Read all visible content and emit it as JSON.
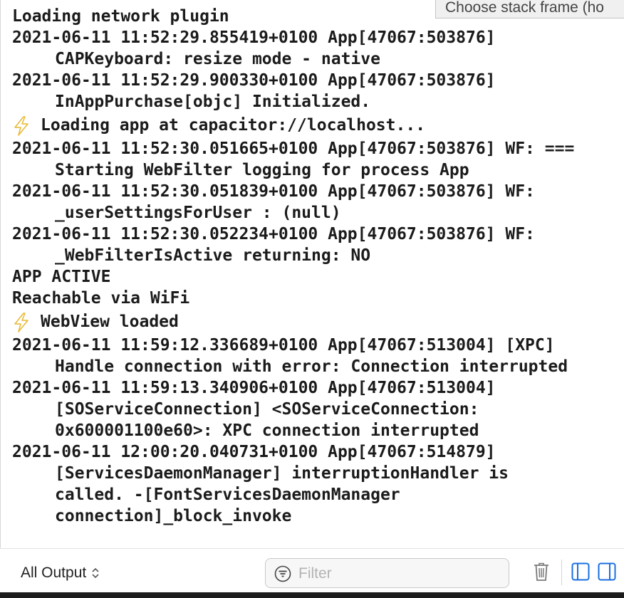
{
  "tooltip": {
    "text": "Choose stack frame (ho"
  },
  "log": [
    {
      "text": "Loading network plugin",
      "cont": false,
      "bolt": false
    },
    {
      "text": "2021-06-11 11:52:29.855419+0100 App[47067:503876]",
      "cont": false,
      "bolt": false
    },
    {
      "text": "CAPKeyboard: resize mode - native",
      "cont": true,
      "bolt": false
    },
    {
      "text": "2021-06-11 11:52:29.900330+0100 App[47067:503876]",
      "cont": false,
      "bolt": false
    },
    {
      "text": "InAppPurchase[objc] Initialized.",
      "cont": true,
      "bolt": false
    },
    {
      "text": "Loading app at capacitor://localhost...",
      "cont": false,
      "bolt": true
    },
    {
      "text": "2021-06-11 11:52:30.051665+0100 App[47067:503876] WF: ===",
      "cont": false,
      "bolt": false
    },
    {
      "text": "Starting WebFilter logging for process App",
      "cont": true,
      "bolt": false
    },
    {
      "text": "2021-06-11 11:52:30.051839+0100 App[47067:503876] WF:",
      "cont": false,
      "bolt": false
    },
    {
      "text": "_userSettingsForUser : (null)",
      "cont": true,
      "bolt": false
    },
    {
      "text": "2021-06-11 11:52:30.052234+0100 App[47067:503876] WF:",
      "cont": false,
      "bolt": false
    },
    {
      "text": "_WebFilterIsActive returning: NO",
      "cont": true,
      "bolt": false
    },
    {
      "text": "APP ACTIVE",
      "cont": false,
      "bolt": false
    },
    {
      "text": "Reachable via WiFi",
      "cont": false,
      "bolt": false
    },
    {
      "text": "WebView loaded",
      "cont": false,
      "bolt": true
    },
    {
      "text": "2021-06-11 11:59:12.336689+0100 App[47067:513004] [XPC]",
      "cont": false,
      "bolt": false
    },
    {
      "text": "Handle connection with error: Connection interrupted",
      "cont": true,
      "bolt": false
    },
    {
      "text": "2021-06-11 11:59:13.340906+0100 App[47067:513004]",
      "cont": false,
      "bolt": false
    },
    {
      "text": "[SOServiceConnection] <SOServiceConnection:",
      "cont": true,
      "bolt": false
    },
    {
      "text": "0x600001100e60>: XPC connection interrupted",
      "cont": true,
      "bolt": false
    },
    {
      "text": "2021-06-11 12:00:20.040731+0100 App[47067:514879]",
      "cont": false,
      "bolt": false
    },
    {
      "text": "[ServicesDaemonManager] interruptionHandler is",
      "cont": true,
      "bolt": false
    },
    {
      "text": "called. -[FontServicesDaemonManager",
      "cont": true,
      "bolt": false
    },
    {
      "text": "connection]_block_invoke",
      "cont": true,
      "bolt": false
    }
  ],
  "toolbar": {
    "output_label": "All Output",
    "output_chevron": "⌃⌄",
    "filter_placeholder": "Filter",
    "filter_value": ""
  },
  "icons": {
    "bolt": "lightning-bolt-icon",
    "filter": "filter-icon",
    "trash": "trash-icon",
    "split_left": "split-left-icon",
    "split_right": "split-right-icon"
  },
  "colors": {
    "accent": "#1a6fe0",
    "bolt": "#e8b830",
    "text": "#1b1b1b"
  }
}
